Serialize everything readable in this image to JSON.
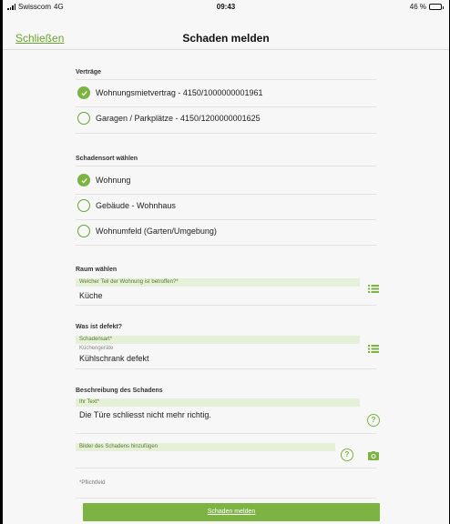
{
  "status_bar": {
    "carrier": "Swisscom",
    "network": "4G",
    "time": "09:43",
    "battery_percent_label": "46 %",
    "battery_level": 0.46
  },
  "navbar": {
    "close_label": "Schließen",
    "title": "Schaden melden"
  },
  "contracts": {
    "title": "Verträge",
    "options": [
      {
        "label": "Wohnungsmietvertrag - 4150/1000000001961",
        "checked": true
      },
      {
        "label": "Garagen / Parkplätze - 4150/1200000001625",
        "checked": false
      }
    ]
  },
  "damage_location": {
    "title": "Schadensort wählen",
    "options": [
      {
        "label": "Wohnung",
        "checked": true
      },
      {
        "label": "Gebäude - Wohnhaus",
        "checked": false
      },
      {
        "label": "Wohnumfeld (Garten/Umgebung)",
        "checked": false
      }
    ]
  },
  "room": {
    "title": "Raum wählen",
    "field_label": "Welcher Teil der Wohnung ist betroffen?*",
    "value": "Küche"
  },
  "defect": {
    "title": "Was ist defekt?",
    "field_label": "Schadensart*",
    "category": "Küchengeräte",
    "value": "Kühlschrank defekt"
  },
  "description": {
    "title": "Beschreibung des Schadens",
    "field_label": "Ihr Text*",
    "value": "Die Türe schliesst nicht mehr richtig.",
    "images_label": "Bilder des Schadens hinzufügen"
  },
  "required_note": "*Pflichtfeld",
  "submit_label": "Schaden melden",
  "colors": {
    "accent": "#7cb342",
    "label_background": "#e6f0d8",
    "link": "#6aa531"
  },
  "icons": {
    "list": "list-icon",
    "help": "help-icon",
    "camera": "camera-icon",
    "check": "checkmark-icon"
  }
}
